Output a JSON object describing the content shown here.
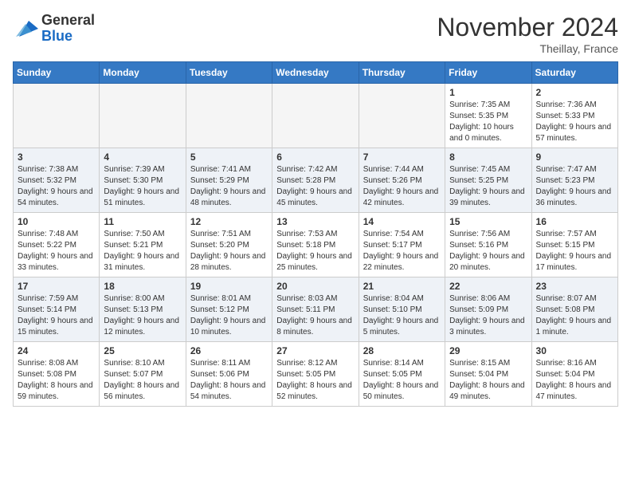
{
  "header": {
    "logo_general": "General",
    "logo_blue": "Blue",
    "month_title": "November 2024",
    "location": "Theillay, France"
  },
  "weekdays": [
    "Sunday",
    "Monday",
    "Tuesday",
    "Wednesday",
    "Thursday",
    "Friday",
    "Saturday"
  ],
  "weeks": [
    [
      {
        "day": "",
        "empty": true
      },
      {
        "day": "",
        "empty": true
      },
      {
        "day": "",
        "empty": true
      },
      {
        "day": "",
        "empty": true
      },
      {
        "day": "",
        "empty": true
      },
      {
        "day": "1",
        "sunrise": "7:35 AM",
        "sunset": "5:35 PM",
        "daylight": "10 hours and 0 minutes."
      },
      {
        "day": "2",
        "sunrise": "7:36 AM",
        "sunset": "5:33 PM",
        "daylight": "9 hours and 57 minutes."
      }
    ],
    [
      {
        "day": "3",
        "sunrise": "7:38 AM",
        "sunset": "5:32 PM",
        "daylight": "9 hours and 54 minutes."
      },
      {
        "day": "4",
        "sunrise": "7:39 AM",
        "sunset": "5:30 PM",
        "daylight": "9 hours and 51 minutes."
      },
      {
        "day": "5",
        "sunrise": "7:41 AM",
        "sunset": "5:29 PM",
        "daylight": "9 hours and 48 minutes."
      },
      {
        "day": "6",
        "sunrise": "7:42 AM",
        "sunset": "5:28 PM",
        "daylight": "9 hours and 45 minutes."
      },
      {
        "day": "7",
        "sunrise": "7:44 AM",
        "sunset": "5:26 PM",
        "daylight": "9 hours and 42 minutes."
      },
      {
        "day": "8",
        "sunrise": "7:45 AM",
        "sunset": "5:25 PM",
        "daylight": "9 hours and 39 minutes."
      },
      {
        "day": "9",
        "sunrise": "7:47 AM",
        "sunset": "5:23 PM",
        "daylight": "9 hours and 36 minutes."
      }
    ],
    [
      {
        "day": "10",
        "sunrise": "7:48 AM",
        "sunset": "5:22 PM",
        "daylight": "9 hours and 33 minutes."
      },
      {
        "day": "11",
        "sunrise": "7:50 AM",
        "sunset": "5:21 PM",
        "daylight": "9 hours and 31 minutes."
      },
      {
        "day": "12",
        "sunrise": "7:51 AM",
        "sunset": "5:20 PM",
        "daylight": "9 hours and 28 minutes."
      },
      {
        "day": "13",
        "sunrise": "7:53 AM",
        "sunset": "5:18 PM",
        "daylight": "9 hours and 25 minutes."
      },
      {
        "day": "14",
        "sunrise": "7:54 AM",
        "sunset": "5:17 PM",
        "daylight": "9 hours and 22 minutes."
      },
      {
        "day": "15",
        "sunrise": "7:56 AM",
        "sunset": "5:16 PM",
        "daylight": "9 hours and 20 minutes."
      },
      {
        "day": "16",
        "sunrise": "7:57 AM",
        "sunset": "5:15 PM",
        "daylight": "9 hours and 17 minutes."
      }
    ],
    [
      {
        "day": "17",
        "sunrise": "7:59 AM",
        "sunset": "5:14 PM",
        "daylight": "9 hours and 15 minutes."
      },
      {
        "day": "18",
        "sunrise": "8:00 AM",
        "sunset": "5:13 PM",
        "daylight": "9 hours and 12 minutes."
      },
      {
        "day": "19",
        "sunrise": "8:01 AM",
        "sunset": "5:12 PM",
        "daylight": "9 hours and 10 minutes."
      },
      {
        "day": "20",
        "sunrise": "8:03 AM",
        "sunset": "5:11 PM",
        "daylight": "9 hours and 8 minutes."
      },
      {
        "day": "21",
        "sunrise": "8:04 AM",
        "sunset": "5:10 PM",
        "daylight": "9 hours and 5 minutes."
      },
      {
        "day": "22",
        "sunrise": "8:06 AM",
        "sunset": "5:09 PM",
        "daylight": "9 hours and 3 minutes."
      },
      {
        "day": "23",
        "sunrise": "8:07 AM",
        "sunset": "5:08 PM",
        "daylight": "9 hours and 1 minute."
      }
    ],
    [
      {
        "day": "24",
        "sunrise": "8:08 AM",
        "sunset": "5:08 PM",
        "daylight": "8 hours and 59 minutes."
      },
      {
        "day": "25",
        "sunrise": "8:10 AM",
        "sunset": "5:07 PM",
        "daylight": "8 hours and 56 minutes."
      },
      {
        "day": "26",
        "sunrise": "8:11 AM",
        "sunset": "5:06 PM",
        "daylight": "8 hours and 54 minutes."
      },
      {
        "day": "27",
        "sunrise": "8:12 AM",
        "sunset": "5:05 PM",
        "daylight": "8 hours and 52 minutes."
      },
      {
        "day": "28",
        "sunrise": "8:14 AM",
        "sunset": "5:05 PM",
        "daylight": "8 hours and 50 minutes."
      },
      {
        "day": "29",
        "sunrise": "8:15 AM",
        "sunset": "5:04 PM",
        "daylight": "8 hours and 49 minutes."
      },
      {
        "day": "30",
        "sunrise": "8:16 AM",
        "sunset": "5:04 PM",
        "daylight": "8 hours and 47 minutes."
      }
    ]
  ]
}
